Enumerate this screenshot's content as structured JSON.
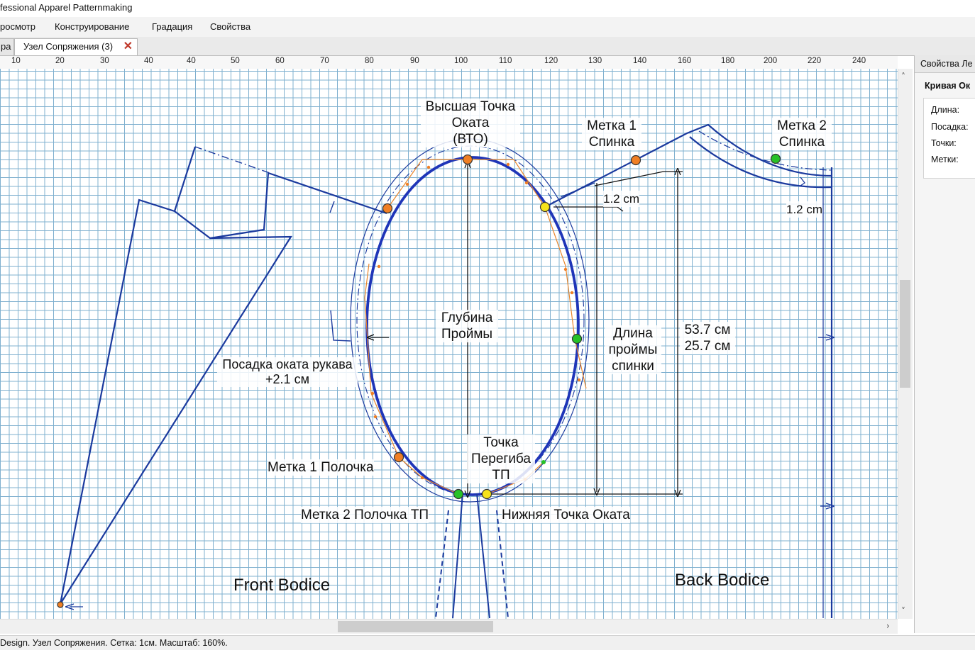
{
  "window": {
    "title": "fessional Apparel Patternmaking"
  },
  "menu": {
    "items": [
      "росмотр",
      "Конструирование",
      "Градация",
      "Свойства"
    ]
  },
  "tabs": [
    {
      "label": "ра",
      "active": false
    },
    {
      "label": "Узел Сопряжения (3)",
      "active": true,
      "close_icon": "close-icon"
    }
  ],
  "ruler": {
    "labels": [
      "10",
      "20",
      "30",
      "40",
      "40",
      "50",
      "60",
      "70",
      "80",
      "90",
      "100",
      "110",
      "120",
      "130",
      "140",
      "160",
      "180",
      "200",
      "220",
      "240"
    ]
  },
  "canvas": {
    "grid_color": "#7fb0cf",
    "line_color": "#1b3a9e",
    "point_colors": {
      "orange": "#f07f24",
      "yellow": "#f6e31c",
      "green": "#27c127"
    },
    "labels": {
      "vto_1": "Высшая Точка",
      "vto_2": "Оката",
      "vto_3": "(ВТО)",
      "mark1_back_1": "Метка 1",
      "mark1_back_2": "Спинка",
      "mark2_back_1": "Метка 2",
      "mark2_back_2": "Спинка",
      "offset_1": "1.2 cm",
      "offset_2": "1.2 cm",
      "depth_1": "Глубина",
      "depth_2": "Проймы",
      "length_1": "Длина",
      "length_2": "проймы",
      "length_3": "спинки",
      "meas_1": "53.7 см",
      "meas_2": "25.7 см",
      "ease_1": "Посадка оката рукава",
      "ease_2": "+2.1 см",
      "fold_1": "Точка",
      "fold_2": "Перегиба",
      "fold_3": "ТП",
      "mark1_front": "Метка 1 Полочка",
      "mark2_front": "Метка 2 Полочка ТП",
      "bottom_point": "Нижняя Точка Оката",
      "front_bodice": "Front Bodice",
      "back_bodice": "Back Bodice"
    }
  },
  "properties_panel": {
    "header": "Свойства Ле",
    "section": "Кривая Ок",
    "fields": [
      "Длина:",
      "Посадка:",
      "Точки:",
      "Метки:"
    ]
  },
  "status": {
    "text": "Design. Узел Сопряжения. Сетка: 1см. Масштаб: 160%."
  }
}
